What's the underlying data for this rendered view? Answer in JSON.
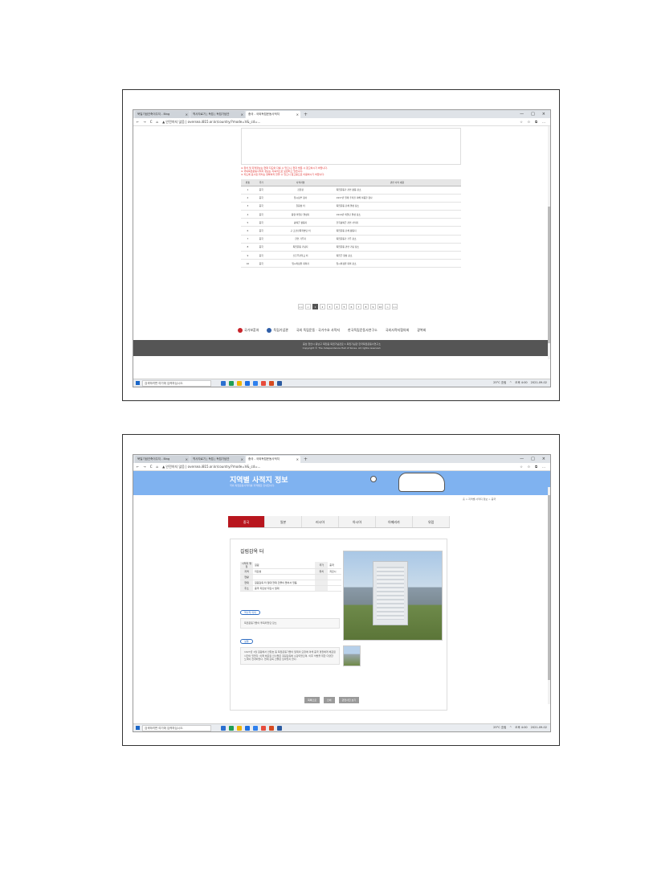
{
  "browser": {
    "tabs_shot1": [
      "북일기념건축이주지 - Bing",
      "역사자료기 | 독립 | 독립기념관",
      "중국 - 국외독립운동사적지"
    ],
    "tabs_shot2": [
      "북일기념건축이주지 - Bing",
      "역사자료기 | 독립 | 독립기념관",
      "중국 - 국외독립운동사적지"
    ],
    "new_tab": "+",
    "window_buttons": [
      "—",
      "□",
      "×"
    ],
    "nav_buttons": [
      "←",
      "→",
      "C",
      "⌂"
    ],
    "url_shot1": "▲ 안전하지 않음  |  oversea.i815.or.kr/country/?mode=V&_cd=...",
    "url_shot2": "▲ 안전하지 않음  |  oversea.i815.or.kr/country/?mode=V&_cd=...",
    "tool_icons": [
      "☆",
      "✩",
      "⧉",
      "…"
    ]
  },
  "taskbar": {
    "search_placeholder": "검색하려면 여기에 입력하십시오.",
    "tray_shot1": [
      "25°C 흐림",
      "^",
      "오후 4:00",
      "2021-09-02"
    ],
    "tray_shot2": [
      "25°C 흐림",
      "^",
      "오후 4:00",
      "2021-09-02"
    ],
    "app_colors": [
      "#2a6fd0",
      "#1e9e55",
      "#f0b400",
      "#1d6fe2",
      "#2f80ed",
      "#e74c3c",
      "#d64a1f",
      "#2b5aa0"
    ]
  },
  "shot1": {
    "notes": [
      "※ 위치 및 지역정보는 현재 지도와 다를 수 있으니, 현지 방문 시 참고하시기 바랍니다.",
      "※ 국외독립운동사적지 정보는 지속적으로 보완되고 있습니다.",
      "※ 지도에 표시된 위치는 정확하지 않을 수 있으니 참고용으로 이용하시기 바랍니다."
    ],
    "table_headers": [
      "번호",
      "국가",
      "사적지명",
      "관련 사적 내용"
    ],
    "rows": [
      [
        "1",
        "중국",
        "집합장",
        "독립운동가 관련 활동 장소"
      ],
      [
        "2",
        "중국",
        "임시정부 청사",
        "1937년 일제 추적을 피해 이동한 청사"
      ],
      [
        "3",
        "중국",
        "길림성 터",
        "독립운동 단체 결성 장소"
      ],
      [
        "4",
        "중국",
        "동양 의열단 결성지",
        "1919년 의열단 결성 장소"
      ],
      [
        "5",
        "중국",
        "광복군 활동지",
        "한국광복군 관련 사적지"
      ],
      [
        "6",
        "중국",
        "구 조선민족혁명당 터",
        "독립운동 단체 활동지"
      ],
      [
        "7",
        "중국",
        "한인 거주지",
        "독립운동가 거주 장소"
      ],
      [
        "8",
        "중국",
        "독립운동 기념지",
        "독립운동 관련 기념 장소"
      ],
      [
        "9",
        "중국",
        "신흥무관학교 터",
        "독립군 양성 장소"
      ],
      [
        "10",
        "중국",
        "임시의정원 회의지",
        "임시의정원 회의 장소"
      ]
    ],
    "pager": [
      "<<",
      "<",
      "1",
      "2",
      "3",
      "4",
      "5",
      "6",
      "7",
      "8",
      "9",
      "10",
      ">",
      ">>"
    ],
    "sponsors": [
      "국가보훈처",
      "독립기념관",
      "국외 독립운동 · 국가수호 사적지",
      "한국독립운동사연구소",
      "국외사적지협의회",
      "광복회"
    ],
    "footer_lines": [
      "충남 천안시 동남구 목천읍 독립기념관로 1 독립기념관 한국독립운동사연구소",
      "Copyright © The Independence Hall of Korea. All rights reserved."
    ]
  },
  "shot2": {
    "banner_title": "지역별 사적지 정보",
    "banner_sub": "국외 독립운동사적지를 지역별로 안내합니다.",
    "breadcrumb": "홈 > 지역별 사적지 정보 > 중국",
    "nav_tabs": [
      "중국",
      "일본",
      "러시아",
      "아시아",
      "아메리카",
      "유럽"
    ],
    "site_name": "길림감옥 터",
    "info_rows": [
      [
        "사적지 명칭",
        "길림",
        "국가",
        "중국"
      ],
      [
        "지역",
        "지린성",
        "위치",
        "지린시"
      ],
      [
        "현황",
        "",
        "",
        ""
      ],
      [
        "현재",
        "길림감옥 터 일대 현재 건물이 들어서 있음",
        "",
        ""
      ],
      [
        "주소",
        "중국 지린성 지린시 일대",
        "",
        ""
      ]
    ],
    "section1_label": "역사적 의의",
    "section1_text": "독립운동가들이 투옥되었던 장소",
    "section2_label": "설명",
    "section2_text": "1927년 1월 길림에서 안창호 등 독립운동가들이 일제의 요청에 의해 중국 경찰에게 체포된 사건이 있었다. 이때 체포된 인사들은 길림감옥에 수감되었으며, 이후 석방을 위한 다양한 노력이 전개되었다. 현재 감옥 건물은 남아있지 않다.",
    "buttons": [
      "목록으로",
      "인쇄",
      "관련사진 보기"
    ]
  }
}
